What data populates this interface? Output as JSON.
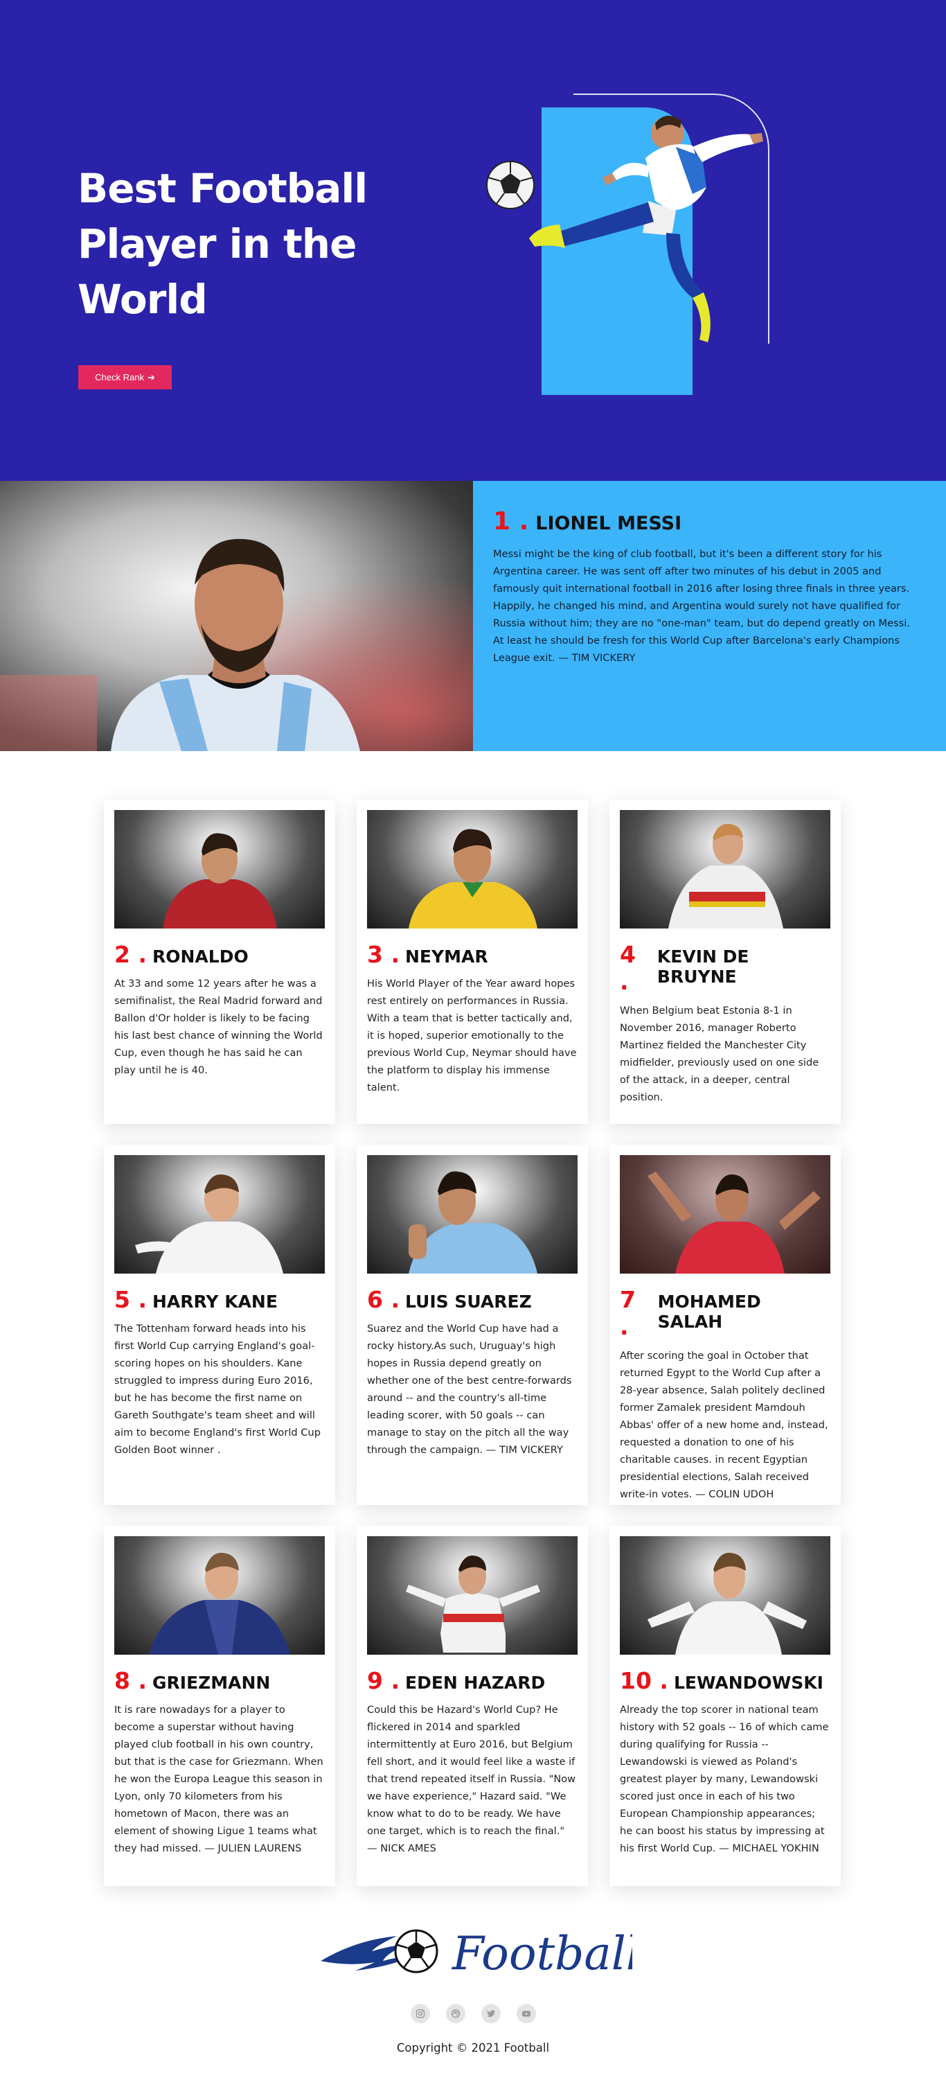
{
  "hero": {
    "title": "Best Football Player in the World",
    "button_label": "Check Rank",
    "button_icon": "arrow-right-icon"
  },
  "featured": {
    "rank": "1 .",
    "name": "LIONEL MESSI",
    "body": "Messi might be the king of club football, but it's been a different story for his Argentina career. He was sent off after two minutes of his debut in 2005 and famously quit international football in 2016 after losing three finals in three years. Happily, he changed his mind, and Argentina would surely not have qualified for Russia without him; they are no \"one-man\" team, but do depend greatly on Messi. At least he should be fresh for this World Cup after Barcelona's early Champions League exit. — TIM VICKERY"
  },
  "players": [
    {
      "rank": "2 .",
      "name": "RONALDO",
      "body": "At 33 and some 12 years after he was a semifinalist, the Real Madrid forward and Ballon d'Or holder is likely to be facing his last best chance of winning the World Cup, even though he has said he can play until he is 40."
    },
    {
      "rank": "3 .",
      "name": "NEYMAR",
      "body": "His World Player of the Year award hopes rest entirely on performances in Russia. With a team that is better tactically and, it is hoped, superior emotionally to the previous World Cup, Neymar should have the platform to display his immense talent."
    },
    {
      "rank": "4 .",
      "name": "KEVIN DE BRUYNE",
      "body": "When Belgium beat Estonia 8-1 in November 2016, manager Roberto Martinez fielded the Manchester City midfielder, previously used on one side of the attack, in a deeper, central position."
    },
    {
      "rank": "5 .",
      "name": "HARRY KANE",
      "body": "The Tottenham forward heads into his first World Cup carrying England's goal-scoring hopes on his shoulders. Kane struggled to impress during Euro 2016, but he has become the first name on Gareth Southgate's team sheet and will aim to become England's first World Cup Golden Boot winner ."
    },
    {
      "rank": "6 .",
      "name": "LUIS SUAREZ",
      "body": "Suarez and the World Cup have had a rocky history.As such, Uruguay's high hopes in Russia depend greatly on whether one of the best centre-forwards around -- and the country's all-time leading scorer, with 50 goals -- can manage to stay on the pitch all the way through the campaign. — TIM VICKERY"
    },
    {
      "rank": "7 .",
      "name": "MOHAMED SALAH",
      "body": "After scoring the goal in October that returned Egypt to the World Cup after a 28-year absence, Salah politely declined former Zamalek president Mamdouh Abbas' offer of a new home and, instead, requested a donation to one of his charitable causes. in recent Egyptian presidential elections, Salah received write-in votes. — COLIN UDOH"
    },
    {
      "rank": "8 .",
      "name": "GRIEZMANN",
      "body": "It is rare nowadays for a player to become a superstar without having played club football in his own country, but that is the case for Griezmann. When he won the Europa League this season in Lyon, only 70 kilometers from his hometown of Macon, there was an element of showing Ligue 1 teams what they had missed. — JULIEN LAURENS"
    },
    {
      "rank": "9 .",
      "name": "EDEN HAZARD",
      "body": "Could this be Hazard's World Cup? He flickered in 2014 and sparkled intermittently at Euro 2016, but Belgium fell short, and it would feel like a waste if that trend repeated itself in Russia. \"Now we have experience,\" Hazard said. \"We know what to do to be ready. We have one target, which is to reach the final.\" — NICK AMES"
    },
    {
      "rank": "10 .",
      "name": "LEWANDOWSKI",
      "body": "Already the top scorer in national team history with 52 goals -- 16 of which came during qualifying for Russia -- Lewandowski is viewed as Poland's greatest player by many, Lewandowski scored just once in each of his two European Championship appearances; he can boost his status by impressing at his first World Cup. — MICHAEL YOKHIN"
    }
  ],
  "footer": {
    "logo_text": "Football",
    "socials": [
      "instagram-icon",
      "dribbble-icon",
      "twitter-icon",
      "youtube-icon"
    ],
    "copyright": "Copyright © 2021 Football"
  },
  "colors": {
    "hero_bg": "#2a22a8",
    "accent_blue": "#3cb4fa",
    "button_pink": "#e2285f",
    "rank_red": "#e8141c",
    "logo_navy": "#1a3a8a"
  }
}
